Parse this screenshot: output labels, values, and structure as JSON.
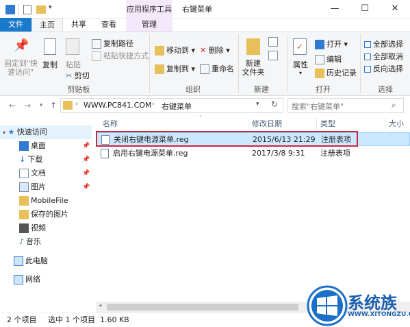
{
  "window": {
    "context_tab": "应用程序工具",
    "title": "右键菜单"
  },
  "tabs": {
    "file": "文件",
    "home": "主页",
    "share": "共享",
    "view": "查看",
    "manage": "管理"
  },
  "ribbon": {
    "clipboard": {
      "pin": "固定到\"快",
      "pin2": "速访问\"",
      "copy": "复制",
      "paste": "粘贴",
      "copy_path": "复制路径",
      "paste_shortcut": "粘贴快捷方式",
      "cut": "剪切",
      "label": "剪贴板"
    },
    "organize": {
      "move_to": "移动到",
      "copy_to": "复制到",
      "delete": "删除",
      "rename": "重命名",
      "label": "组织"
    },
    "new": {
      "new_folder": "新建",
      "new_folder2": "文件夹",
      "label": "新建"
    },
    "open": {
      "properties": "属性",
      "open": "打开",
      "edit": "编辑",
      "history": "历史记录",
      "label": "打开"
    },
    "select": {
      "select_all": "全部选择",
      "select_none": "全部取消",
      "invert": "反向选择",
      "label": "选择"
    }
  },
  "address": {
    "root": "WWW.PC841.COM",
    "folder": "右键菜单",
    "search_placeholder": "搜索\"右键菜单\""
  },
  "nav": {
    "quick_access": "快速访问",
    "items": [
      "桌面",
      "下载",
      "文档",
      "图片",
      "MobileFile",
      "保存的图片",
      "视频",
      "音乐"
    ],
    "this_pc": "此电脑",
    "network": "网络"
  },
  "columns": {
    "name": "名称",
    "modified": "修改日期",
    "type": "类型",
    "size": "大小"
  },
  "files": [
    {
      "name": "关闭右键电源菜单.reg",
      "modified": "2015/6/13 21:29",
      "type": "注册表项"
    },
    {
      "name": "启用右键电源菜单.reg",
      "modified": "2017/3/8 9:31",
      "type": "注册表项"
    }
  ],
  "status": {
    "count": "2 个项目",
    "selected": "选中 1 个项目  1.60 KB"
  },
  "watermark": {
    "brand": "系统族",
    "url": "WWW.XITONGZU.COM"
  },
  "colors": {
    "accent": "#1979ca",
    "selection": "#cce8ff",
    "highlight_border": "#c8283c"
  }
}
